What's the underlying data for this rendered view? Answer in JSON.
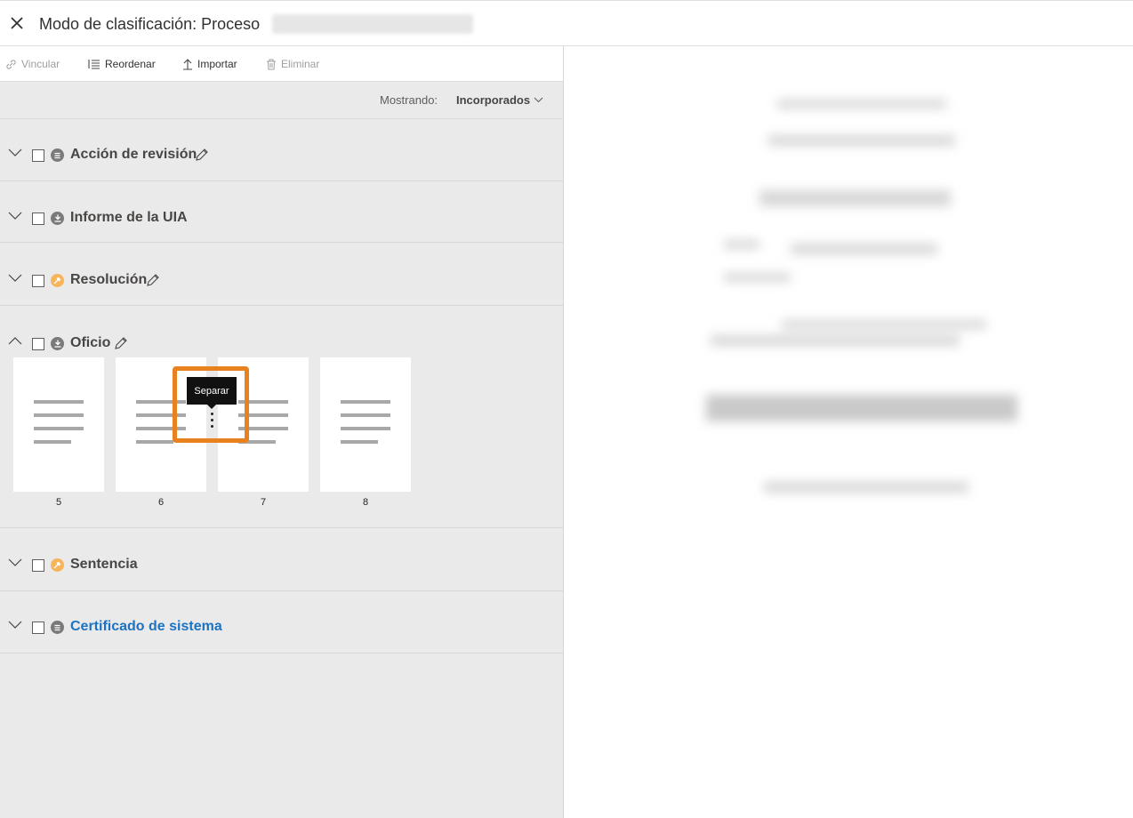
{
  "header": {
    "title": "Modo de clasificación: Proceso"
  },
  "toolbar": {
    "link_label": "Vincular",
    "reorder_label": "Reordenar",
    "import_label": "Importar",
    "delete_label": "Eliminar"
  },
  "filter": {
    "label": "Mostrando:",
    "value": "Incorporados"
  },
  "sections": [
    {
      "title": "Acción de revisión",
      "icon": "document-icon",
      "color": "#7a7a7a",
      "expanded": false,
      "editable": true
    },
    {
      "title": "Informe de la UIA",
      "icon": "download-icon",
      "color": "#7a7a7a",
      "expanded": false,
      "editable": false
    },
    {
      "title": "Resolución",
      "icon": "gavel-icon",
      "color": "#f7b45a",
      "expanded": false,
      "editable": true
    },
    {
      "title": "Oficio",
      "icon": "download-icon",
      "color": "#7a7a7a",
      "expanded": true,
      "editable": true
    },
    {
      "title": "Sentencia",
      "icon": "gavel-icon",
      "color": "#f7b45a",
      "expanded": false,
      "editable": false
    },
    {
      "title": "Certificado de sistema",
      "icon": "document-icon",
      "color": "#7a7a7a",
      "expanded": false,
      "editable": false,
      "link_color": "#1c73c2"
    }
  ],
  "pages": [
    "5",
    "6",
    "7",
    "8"
  ],
  "tooltip": {
    "text": "Separar"
  },
  "colors": {
    "highlight": "#e8821f",
    "link": "#1c73c2"
  }
}
